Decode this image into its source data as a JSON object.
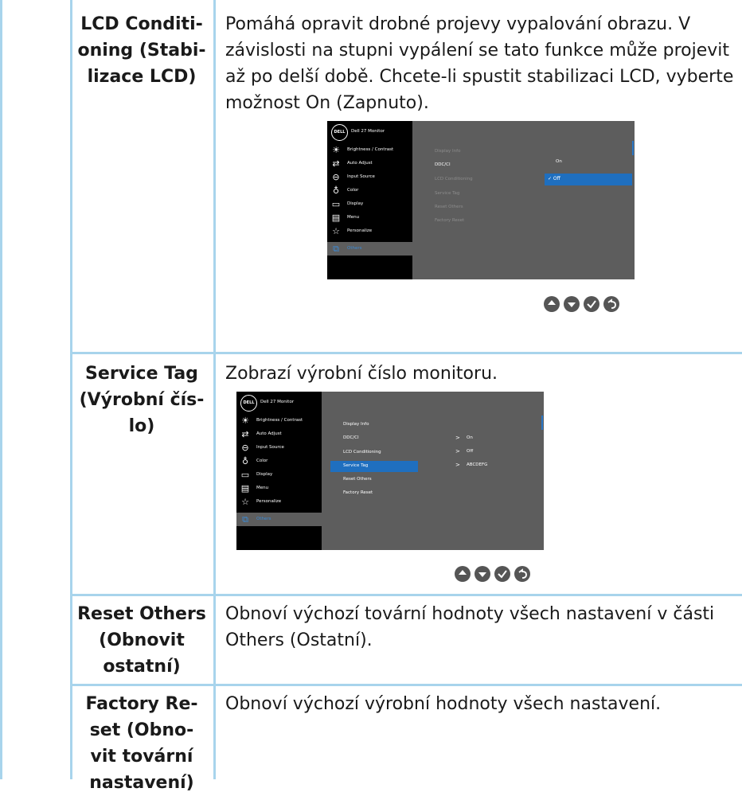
{
  "rows": [
    {
      "label_lines": [
        "LCD Conditi-",
        "oning (Stabi-",
        "lizace LCD)"
      ],
      "desc_lines": [
        "Pomáhá opravit drobné projevy vypalování obrazu. V",
        "závislosti na stupni vypálení se tato funkce může projevit",
        "až po delší době. Chcete-li spustit stabilizaci LCD, vyberte",
        "možnost On (Zapnuto)."
      ]
    },
    {
      "label_lines": [
        "Service Tag",
        "(Výrobní čís-",
        "lo)"
      ],
      "desc_lines": [
        "Zobrazí výrobní číslo monitoru."
      ]
    },
    {
      "label_lines": [
        "Reset Others",
        "(Obnovit",
        "ostatní)"
      ],
      "desc_lines": [
        "Obnoví výchozí tovární hodnoty všech nastavení v části",
        "Others (Ostatní)."
      ]
    },
    {
      "label_lines": [
        "Factory Re-",
        "set (Obno-",
        "vit tovární",
        "nastavení)"
      ],
      "desc_lines": [
        "Obnoví výchozí výrobní hodnoty všech nastavení."
      ]
    }
  ],
  "osd_common": {
    "logo": "DELL",
    "title": "Dell 27 Monitor",
    "menu": [
      {
        "label": "Brightness / Contrast",
        "icon": "☀"
      },
      {
        "label": "Auto Adjust",
        "icon": "⇄"
      },
      {
        "label": "Input Source",
        "icon": "⊖"
      },
      {
        "label": "Color",
        "icon": "♁"
      },
      {
        "label": "Display",
        "icon": "▭"
      },
      {
        "label": "Menu",
        "icon": "▤"
      },
      {
        "label": "Personalize",
        "icon": "☆"
      },
      {
        "label": "Others",
        "icon": "⧉"
      }
    ],
    "submenu": [
      "Display Info",
      "DDC/CI",
      "LCD Conditioning",
      "Service Tag",
      "Reset Others",
      "Factory Reset"
    ]
  },
  "osd1": {
    "options": [
      "On",
      "Off"
    ],
    "selected_option": "✓ Off"
  },
  "osd2": {
    "values": [
      "On",
      "Off",
      "ABCDEFG"
    ],
    "value_prefix": ">"
  },
  "colors": {
    "accent": "#a8d4ec",
    "osd_highlight": "#1f6fbf",
    "osd_bg_right": "#5d5d5d"
  },
  "button_icons": [
    "up-arrow-icon",
    "down-arrow-icon",
    "check-icon",
    "back-icon"
  ]
}
